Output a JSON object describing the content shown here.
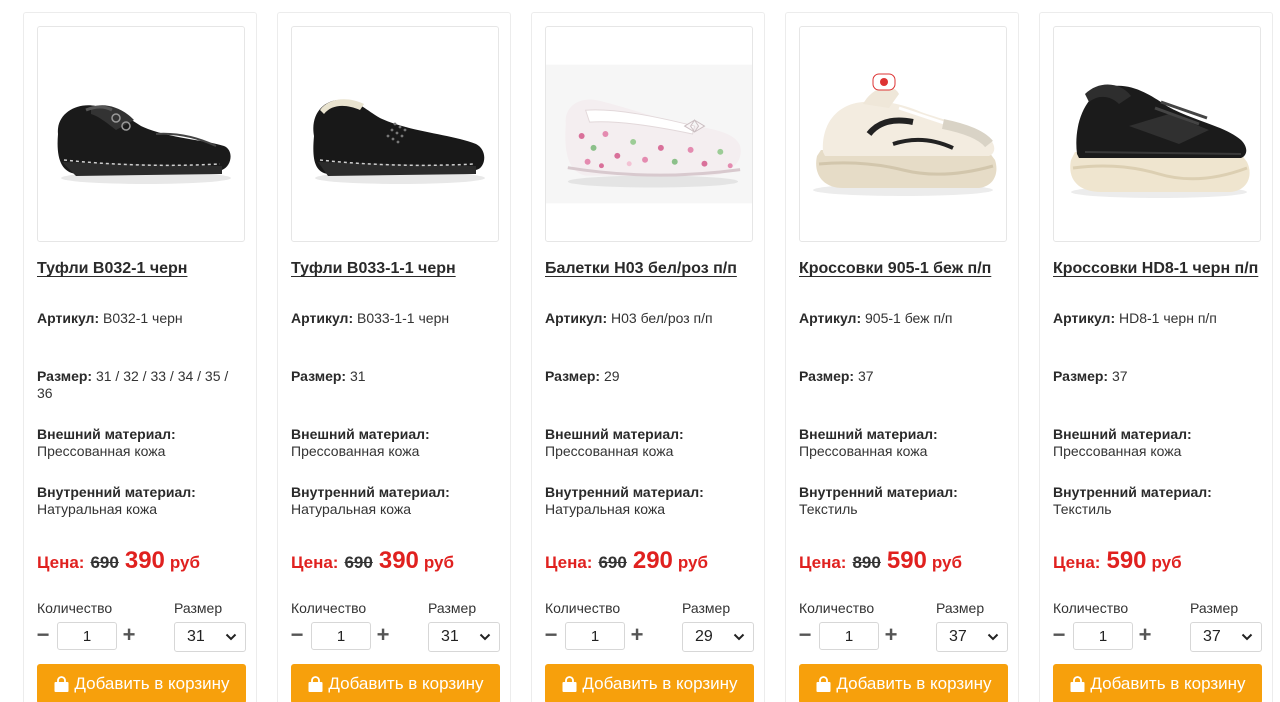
{
  "labels": {
    "article": "Артикул:",
    "size": "Размер:",
    "outer": "Внешний материал:",
    "inner": "Внутренний материал:",
    "price": "Цена:",
    "currency": "руб",
    "quantity": "Количество",
    "size_select": "Размер",
    "add_to_cart": "Добавить в корзину"
  },
  "colors": {
    "accent_orange": "#f7a00c",
    "price_red": "#e0211f"
  },
  "products": [
    {
      "title": "Туфли B032-1 черн",
      "article": "B032-1 черн",
      "sizes": "31 / 32 / 33 / 34 / 35 / 36",
      "outer": "Прессованная кожа",
      "inner": "Натуральная кожа",
      "old_price": "690",
      "price": "390",
      "qty": "1",
      "selected_size": "31",
      "image": "black-leather-shoe-laced"
    },
    {
      "title": "Туфли B033-1-1 черн",
      "article": "B033-1-1 черн",
      "sizes": "31",
      "outer": "Прессованная кожа",
      "inner": "Натуральная кожа",
      "old_price": "690",
      "price": "390",
      "qty": "1",
      "selected_size": "31",
      "image": "black-leather-slip-on-shoe"
    },
    {
      "title": "Балетки H03 бел/роз п/п",
      "article": "H03 бел/роз п/п",
      "sizes": "29",
      "outer": "Прессованная кожа",
      "inner": "Натуральная кожа",
      "old_price": "690",
      "price": "290",
      "qty": "1",
      "selected_size": "29",
      "image": "floral-ballet-flat"
    },
    {
      "title": "Кроссовки 905-1 беж п/п",
      "article": "905-1 беж п/п",
      "sizes": "37",
      "outer": "Прессованная кожа",
      "inner": "Текстиль",
      "old_price": "890",
      "price": "590",
      "qty": "1",
      "selected_size": "37",
      "image": "beige-chunky-sneaker"
    },
    {
      "title": "Кроссовки HD8-1 черн п/п",
      "article": "HD8-1 черн п/п",
      "sizes": "37",
      "outer": "Прессованная кожа",
      "inner": "Текстиль",
      "old_price": "",
      "price": "590",
      "qty": "1",
      "selected_size": "37",
      "image": "black-chunky-sneaker"
    }
  ]
}
